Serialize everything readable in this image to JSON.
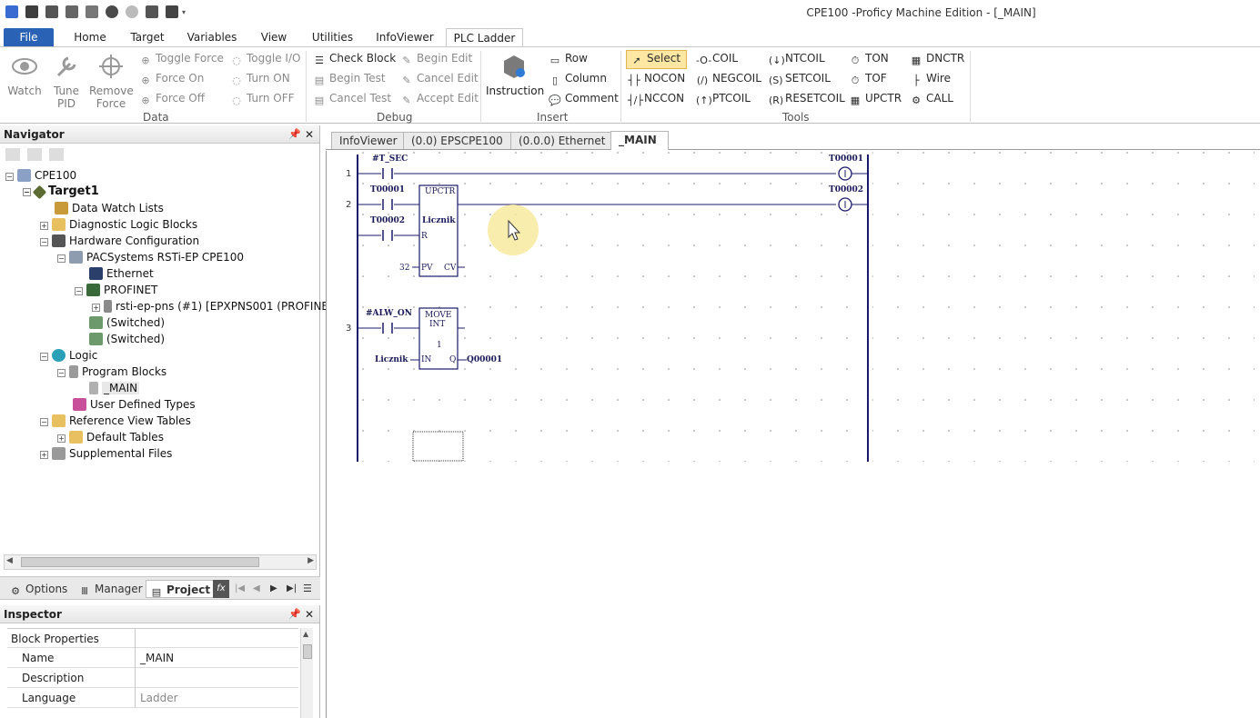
{
  "window": {
    "title": "CPE100 -Proficy Machine Edition - [_MAIN]"
  },
  "ribbon_tabs": [
    {
      "label": "File"
    },
    {
      "label": "Home"
    },
    {
      "label": "Target"
    },
    {
      "label": "Variables"
    },
    {
      "label": "View"
    },
    {
      "label": "Utilities"
    },
    {
      "label": "InfoViewer"
    },
    {
      "label": "PLC Ladder"
    }
  ],
  "data_group": {
    "label": "Data",
    "watch": "Watch",
    "tune1": "Tune",
    "tune2": "PID",
    "remove1": "Remove",
    "remove2": "Force",
    "toggle_force": "Toggle Force",
    "force_on": "Force On",
    "force_off": "Force Off",
    "toggle_io": "Toggle I/O",
    "turn_on": "Turn ON",
    "turn_off": "Turn OFF"
  },
  "debug_group": {
    "label": "Debug",
    "check_block": "Check Block",
    "begin_test": "Begin Test",
    "cancel_test": "Cancel Test",
    "begin_edit": "Begin Edit",
    "cancel_edit": "Cancel Edit",
    "accept_edit": "Accept Edit"
  },
  "insert_group": {
    "label": "Insert",
    "instruction": "Instruction",
    "row": "Row",
    "column": "Column",
    "comment": "Comment"
  },
  "tools_group": {
    "label": "Tools",
    "select": "Select",
    "nocon": "NOCON",
    "nccon": "NCCON",
    "coil": "COIL",
    "negcoil": "NEGCOIL",
    "ptcoil": "PTCOIL",
    "ntcoil": "NTCOIL",
    "setcoil": "SETCOIL",
    "resetcoil": "RESETCOIL",
    "ton": "TON",
    "tof": "TOF",
    "upctr": "UPCTR",
    "dnctr": "DNCTR",
    "wire": "Wire",
    "call": "CALL"
  },
  "navigator": {
    "title": "Navigator",
    "tree": [
      "CPE100",
      "Target1",
      "Data Watch Lists",
      "Diagnostic Logic Blocks",
      "Hardware Configuration",
      "PACSystems RSTi-EP CPE100",
      "Ethernet",
      "PROFINET",
      "rsti-ep-pns (#1) [EPXPNS001 (PROFINET",
      "(Switched)",
      "(Switched)",
      "Logic",
      "Program Blocks",
      "_MAIN",
      "User Defined Types",
      "Reference View Tables",
      "Default Tables",
      "Supplemental Files"
    ]
  },
  "bottom_tabs": {
    "options": "Options",
    "manager": "Manager",
    "project": "Project",
    "fx": "fx"
  },
  "inspector": {
    "title": "Inspector",
    "section": "Block Properties",
    "rows": [
      {
        "key": "Name",
        "value": "_MAIN"
      },
      {
        "key": "Description",
        "value": ""
      },
      {
        "key": "Language",
        "value": "Ladder"
      }
    ]
  },
  "doc_tabs": [
    {
      "label": "InfoViewer"
    },
    {
      "label": "(0.0) EPSCPE100"
    },
    {
      "label": "(0.0.0) Ethernet"
    },
    {
      "label": "_MAIN"
    }
  ],
  "ladder": {
    "rung1": {
      "num": "1",
      "contact": "#T_SEC",
      "coil": "T00001"
    },
    "rung2": {
      "num": "2",
      "contact1": "T00001",
      "contact2": "T00002",
      "coil": "T00002",
      "block_title": "UPCTR",
      "block_var": "Licznik",
      "r_label": "R",
      "pv_label": "PV",
      "cv_label": "CV",
      "pv_value": "32"
    },
    "rung3": {
      "num": "3",
      "contact": "#ALW_ON",
      "block_title": "MOVE",
      "block_type": "INT",
      "block_len": "1",
      "in_label": "IN",
      "q_label": "Q",
      "in_var": "Licznik",
      "out_var": "Q00001"
    }
  }
}
